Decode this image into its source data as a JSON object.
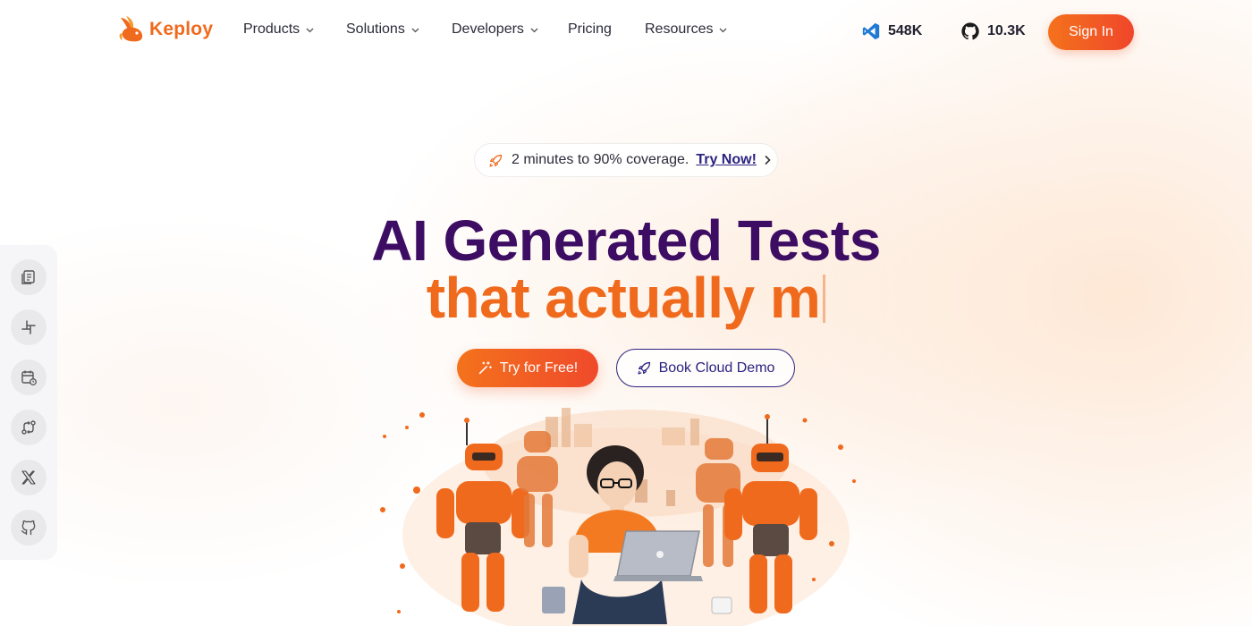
{
  "brand": {
    "name": "Keploy",
    "color": "#f06a1d"
  },
  "nav": {
    "items": [
      {
        "label": "Products",
        "dropdown": true
      },
      {
        "label": "Solutions",
        "dropdown": true
      },
      {
        "label": "Developers",
        "dropdown": true
      },
      {
        "label": "Pricing",
        "dropdown": false
      },
      {
        "label": "Resources",
        "dropdown": true
      }
    ],
    "vscode_count": "548K",
    "github_count": "10.3K",
    "signin_label": "Sign In"
  },
  "sidebar": {
    "items": [
      {
        "icon": "docs-icon"
      },
      {
        "icon": "slack-icon"
      },
      {
        "icon": "calendar-icon"
      },
      {
        "icon": "git-compare-icon"
      },
      {
        "icon": "x-icon"
      },
      {
        "icon": "github-icon"
      }
    ]
  },
  "hero": {
    "pill_text": "2 minutes to 90% coverage.",
    "pill_link": "Try Now!",
    "title_line1": "AI Generated Tests",
    "title_line2": "that actually m",
    "cta_primary": "Try for Free!",
    "cta_secondary": "Book Cloud Demo"
  },
  "colors": {
    "accent": "#f06a1d",
    "accent_red": "#ef4a2b",
    "heading_purple": "#3d0d63",
    "link_indigo": "#2c2280"
  }
}
